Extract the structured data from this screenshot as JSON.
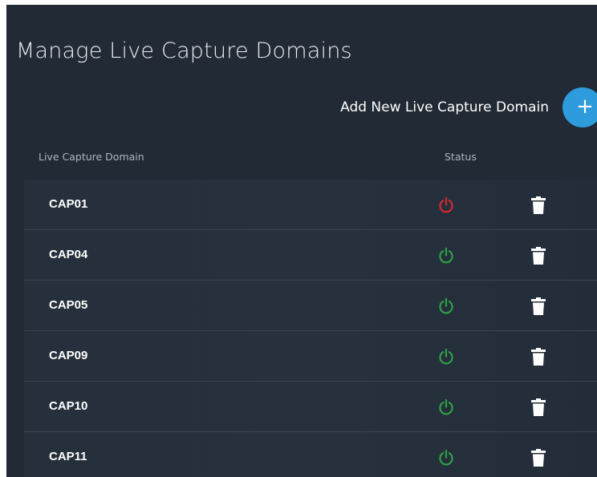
{
  "page": {
    "title": "Manage Live Capture Domains",
    "add_label": "Add New Live Capture Domain",
    "add_button_glyph": "+"
  },
  "table": {
    "headers": {
      "domain": "Live Capture Domain",
      "status": "Status"
    },
    "rows": [
      {
        "name": "CAP01",
        "status": "off",
        "status_color": "#d62a2a"
      },
      {
        "name": "CAP04",
        "status": "on",
        "status_color": "#2ea042"
      },
      {
        "name": "CAP05",
        "status": "on",
        "status_color": "#2ea042"
      },
      {
        "name": "CAP09",
        "status": "on",
        "status_color": "#2ea042"
      },
      {
        "name": "CAP10",
        "status": "on",
        "status_color": "#2ea042"
      },
      {
        "name": "CAP11",
        "status": "on",
        "status_color": "#2ea042"
      }
    ]
  },
  "icons": {
    "status": "power-icon",
    "delete": "trash-icon",
    "add": "plus-icon"
  },
  "colors": {
    "background": "#212a35",
    "accent": "#2d9bdc",
    "status_on": "#2ea042",
    "status_off": "#d62a2a"
  }
}
